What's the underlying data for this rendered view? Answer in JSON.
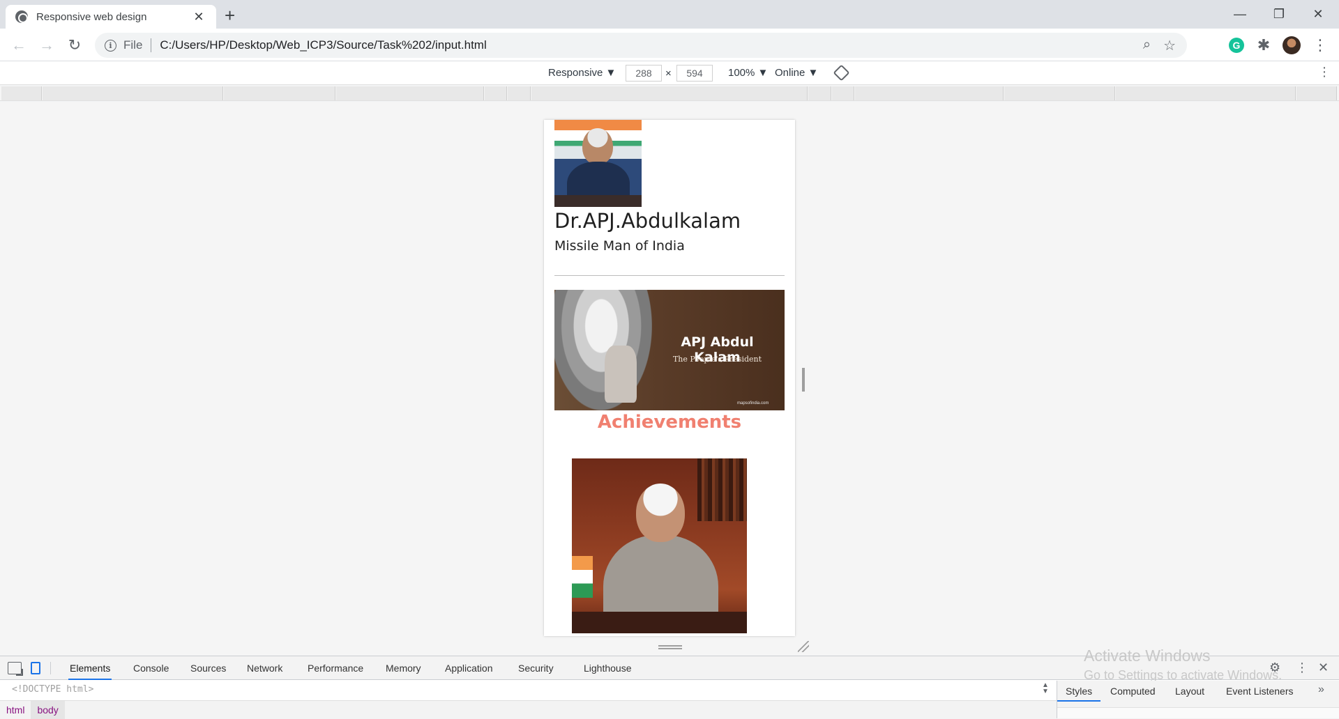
{
  "browser": {
    "tab_title": "Responsive web design",
    "new_tab_label": "+",
    "window": {
      "minimize": "—",
      "restore": "❐",
      "close": "✕"
    },
    "nav": {
      "back": "←",
      "forward": "→",
      "reload": "↻"
    },
    "address": {
      "scheme": "File",
      "url": "C:/Users/HP/Desktop/Web_ICP3/Source/Task%202/input.html"
    },
    "icons": {
      "zoom": "⌕",
      "bookmark": "☆",
      "extensions": "✱",
      "menu": "⋮",
      "grammarly": "G"
    }
  },
  "device_toolbar": {
    "device": "Responsive ▼",
    "width": "288",
    "times": "×",
    "height": "594",
    "zoom": "100% ▼",
    "throttle": "Online ▼",
    "more": "⋮"
  },
  "page": {
    "name": "Dr.APJ.Abdulkalam",
    "tagline": "Missile Man of India",
    "banner_title": "APJ Abdul Kalam",
    "banner_subtitle": "The People's President",
    "banner_credit": "mapsofindia.com",
    "section_heading": "Achievements"
  },
  "devtools": {
    "tabs": [
      "Elements",
      "Console",
      "Sources",
      "Network",
      "Performance",
      "Memory",
      "Application",
      "Security",
      "Lighthouse"
    ],
    "doctype": "<!DOCTYPE html>",
    "breadcrumbs": [
      "html",
      "body"
    ],
    "side_tabs": [
      "Styles",
      "Computed",
      "Layout",
      "Event Listeners"
    ],
    "side_more": "»",
    "gear": "⚙",
    "menu": "⋮",
    "close": "✕"
  },
  "watermark": {
    "line1": "Activate Windows",
    "line2": "Go to Settings to activate Windows."
  },
  "colors": {
    "accent": "#1a73e8",
    "heading_salmon": "#f08070",
    "chrome_tabstrip": "#dee1e6"
  }
}
